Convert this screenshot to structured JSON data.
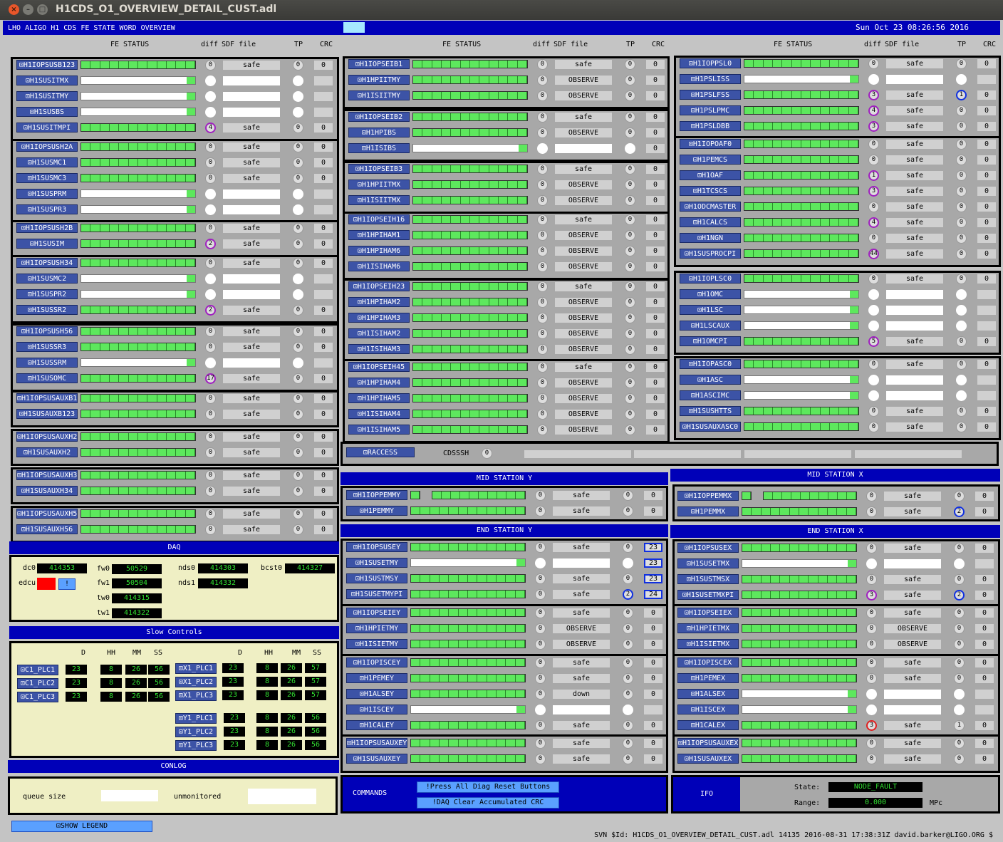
{
  "window": {
    "title": "H1CDS_O1_OVERVIEW_DETAIL_CUST.adl"
  },
  "header": {
    "title": "LHO ALIGO H1 CDS FE STATE WORD OVERVIEW",
    "datetime": "Sun Oct 23 08:26:56 2016"
  },
  "colheaders": {
    "fe": "FE STATUS",
    "diff": "diff",
    "sdf": "SDF file",
    "tp": "TP",
    "crc": "CRC"
  },
  "columns": [
    {
      "groups": [
        [
          [
            "H1IOPSUSB123",
            "g",
            "0",
            "safe",
            "0",
            "0"
          ],
          [
            "H1SUSITMX",
            "w",
            "",
            "",
            "",
            ""
          ],
          [
            "H1SUSITMY",
            "w",
            "",
            "",
            "",
            ""
          ],
          [
            "H1SUSBS",
            "w",
            "",
            "",
            "",
            ""
          ],
          [
            "H1SUSITMPI",
            "g",
            "4p",
            "safe",
            "0",
            "0"
          ]
        ],
        [
          [
            "H1IOPSUSH2A",
            "g",
            "0",
            "safe",
            "0",
            "0"
          ],
          [
            "H1SUSMC1",
            "g",
            "0",
            "safe",
            "0",
            "0"
          ],
          [
            "H1SUSMC3",
            "g",
            "0",
            "safe",
            "0",
            "0"
          ],
          [
            "H1SUSPRM",
            "w",
            "",
            "",
            "",
            ""
          ],
          [
            "H1SUSPR3",
            "w",
            "",
            "",
            "",
            ""
          ]
        ],
        [
          [
            "H1IOPSUSH2B",
            "g",
            "0",
            "safe",
            "0",
            "0"
          ],
          [
            "H1SUSIM",
            "g",
            "2p",
            "safe",
            "0",
            "0"
          ]
        ],
        [
          [
            "H1IOPSUSH34",
            "g",
            "0",
            "safe",
            "0",
            "0"
          ],
          [
            "H1SUSMC2",
            "w",
            "",
            "",
            "",
            ""
          ],
          [
            "H1SUSPR2",
            "w",
            "",
            "",
            "",
            ""
          ],
          [
            "H1SUSSR2",
            "g",
            "2p",
            "safe",
            "0",
            "0"
          ]
        ],
        [
          [
            "H1IOPSUSH56",
            "g",
            "0",
            "safe",
            "0",
            "0"
          ],
          [
            "H1SUSSR3",
            "g",
            "0",
            "safe",
            "0",
            "0"
          ],
          [
            "H1SUSSRM",
            "w",
            "",
            "",
            "",
            ""
          ],
          [
            "H1SUSOMC",
            "g",
            "17p",
            "safe",
            "0",
            "0"
          ]
        ],
        [
          [
            "H1IOPSUSAUXB123",
            "g",
            "0",
            "safe",
            "0",
            "0"
          ],
          [
            "H1SUSAUXB123",
            "g",
            "0",
            "safe",
            "0",
            "0"
          ]
        ],
        [
          [
            "H1IOPSUSAUXH2",
            "g",
            "0",
            "safe",
            "0",
            "0"
          ],
          [
            "H1SUSAUXH2",
            "g",
            "0",
            "safe",
            "0",
            "0"
          ]
        ],
        [
          [
            "H1IOPSUSAUXH34",
            "g",
            "0",
            "safe",
            "0",
            "0"
          ],
          [
            "H1SUSAUXH34",
            "g",
            "0",
            "safe",
            "0",
            "0"
          ]
        ],
        [
          [
            "H1IOPSUSAUXH56",
            "g",
            "0",
            "safe",
            "0",
            "0"
          ],
          [
            "H1SUSAUXH56",
            "g",
            "0",
            "safe",
            "0",
            "0"
          ]
        ]
      ]
    },
    {
      "groups": [
        [
          [
            "H1IOPSEIB1",
            "g",
            "0",
            "safe",
            "0",
            "0"
          ],
          [
            "H1HPIITMY",
            "g",
            "0",
            "OBSERVE",
            "0",
            "0"
          ],
          [
            "H1ISIITMY",
            "g",
            "0",
            "OBSERVE",
            "0",
            "0"
          ]
        ],
        [
          [
            "H1IOPSEIB2",
            "g",
            "0",
            "safe",
            "0",
            "0"
          ],
          [
            "H1HPIBS",
            "g",
            "0",
            "OBSERVE",
            "0",
            "0"
          ],
          [
            "H1ISIBS",
            "w",
            "",
            "",
            "",
            "0"
          ]
        ],
        [
          [
            "H1IOPSEIB3",
            "g",
            "0",
            "safe",
            "0",
            "0"
          ],
          [
            "H1HPIITMX",
            "g",
            "0",
            "OBSERVE",
            "0",
            "0"
          ],
          [
            "H1ISIITMX",
            "g",
            "0",
            "OBSERVE",
            "0",
            "0"
          ]
        ],
        [
          [
            "H1IOPSEIH16",
            "g",
            "0",
            "safe",
            "0",
            "0"
          ],
          [
            "H1HPIHAM1",
            "g",
            "0",
            "OBSERVE",
            "0",
            "0"
          ],
          [
            "H1HPIHAM6",
            "g",
            "0",
            "OBSERVE",
            "0",
            "0"
          ],
          [
            "H1ISIHAM6",
            "g",
            "0",
            "OBSERVE",
            "0",
            "0"
          ]
        ],
        [
          [
            "H1IOPSEIH23",
            "g",
            "0",
            "safe",
            "0",
            "0"
          ],
          [
            "H1HPIHAM2",
            "g",
            "0",
            "OBSERVE",
            "0",
            "0"
          ],
          [
            "H1HPIHAM3",
            "g",
            "0",
            "OBSERVE",
            "0",
            "0"
          ],
          [
            "H1ISIHAM2",
            "g",
            "0",
            "OBSERVE",
            "0",
            "0"
          ],
          [
            "H1ISIHAM3",
            "g",
            "0",
            "OBSERVE",
            "0",
            "0"
          ]
        ],
        [
          [
            "H1IOPSEIH45",
            "g",
            "0",
            "safe",
            "0",
            "0"
          ],
          [
            "H1HPIHAM4",
            "g",
            "0",
            "OBSERVE",
            "0",
            "0"
          ],
          [
            "H1HPIHAM5",
            "g",
            "0",
            "OBSERVE",
            "0",
            "0"
          ],
          [
            "H1ISIHAM4",
            "g",
            "0",
            "OBSERVE",
            "0",
            "0"
          ],
          [
            "H1ISIHAM5",
            "g",
            "0",
            "OBSERVE",
            "0",
            "0"
          ]
        ]
      ]
    },
    {
      "groups": [
        [
          [
            "H1IOPPSL0",
            "g",
            "0",
            "safe",
            "0",
            "0"
          ],
          [
            "H1PSLISS",
            "w",
            "",
            "",
            "",
            ""
          ],
          [
            "H1PSLFSS",
            "g",
            "3p",
            "safe",
            "1b",
            "0"
          ],
          [
            "H1PSLPMC",
            "g",
            "4p",
            "safe",
            "0",
            "0"
          ],
          [
            "H1PSLDBB",
            "g",
            "3p",
            "safe",
            "0",
            "0"
          ]
        ],
        [
          [
            "H1IOPOAF0",
            "g",
            "0",
            "safe",
            "0",
            "0"
          ],
          [
            "H1PEMCS",
            "g",
            "0",
            "safe",
            "0",
            "0"
          ],
          [
            "H1OAF",
            "g",
            "1p",
            "safe",
            "0",
            "0"
          ],
          [
            "H1TCSCS",
            "g",
            "3p",
            "safe",
            "0",
            "0"
          ],
          [
            "H1ODCMASTER",
            "g",
            "0",
            "safe",
            "0",
            "0"
          ],
          [
            "H1CALCS",
            "g",
            "4p",
            "safe",
            "0",
            "0"
          ],
          [
            "H1NGN",
            "g",
            "0",
            "safe",
            "0",
            "0"
          ],
          [
            "H1SUSPROCPI",
            "g",
            "44p",
            "safe",
            "0",
            "0"
          ]
        ],
        [
          [
            "H1IOPLSC0",
            "g",
            "0",
            "safe",
            "0",
            "0"
          ],
          [
            "H1OMC",
            "w",
            "",
            "",
            "",
            ""
          ],
          [
            "H1LSC",
            "w",
            "",
            "",
            "",
            ""
          ],
          [
            "H1LSCAUX",
            "w",
            "",
            "",
            "",
            ""
          ],
          [
            "H1OMCPI",
            "g",
            "5p",
            "safe",
            "0",
            "0"
          ]
        ],
        [
          [
            "H1IOPASC0",
            "g",
            "0",
            "safe",
            "0",
            "0"
          ],
          [
            "H1ASC",
            "w",
            "",
            "",
            "",
            ""
          ],
          [
            "H1ASCIMC",
            "w",
            "",
            "",
            "",
            ""
          ],
          [
            "H1SUSHTTS",
            "g",
            "0",
            "safe",
            "0",
            "0"
          ],
          [
            "H1SUSAUXASC0",
            "g",
            "0",
            "safe",
            "0",
            "0"
          ]
        ]
      ]
    }
  ],
  "raccess": {
    "button": "RACCESS",
    "label": "CDSSSH",
    "value": "0"
  },
  "midy": {
    "title": "MID STATION Y",
    "rows": [
      [
        "H1IOPPEMMY",
        "s",
        "0",
        "safe",
        "0",
        "0"
      ],
      [
        "H1PEMMY",
        "g",
        "0",
        "safe",
        "0",
        "0"
      ]
    ]
  },
  "midx": {
    "title": "MID STATION X",
    "rows": [
      [
        "H1IOPPEMMX",
        "s",
        "0",
        "safe",
        "0",
        "0"
      ],
      [
        "H1PEMMX",
        "g",
        "0",
        "safe",
        "2b",
        "0"
      ]
    ]
  },
  "endy": {
    "title": "END STATION Y",
    "groups": [
      [
        [
          "H1IOPSUSEY",
          "g",
          "0",
          "safe",
          "0",
          "23b"
        ],
        [
          "H1SUSETMY",
          "w",
          "",
          "",
          "",
          "23b"
        ],
        [
          "H1SUSTMSY",
          "g",
          "0",
          "safe",
          "0",
          "23b"
        ],
        [
          "H1SUSETMYPI",
          "g",
          "0",
          "safe",
          "2b",
          "24b"
        ]
      ],
      [
        [
          "H1IOPSEIEY",
          "g",
          "0",
          "safe",
          "0",
          "0"
        ],
        [
          "H1HPIETMY",
          "g",
          "0",
          "OBSERVE",
          "0",
          "0"
        ],
        [
          "H1ISIETMY",
          "g",
          "0",
          "OBSERVE",
          "0",
          "0"
        ]
      ],
      [
        [
          "H1IOPISCEY",
          "g",
          "0",
          "safe",
          "0",
          "0"
        ],
        [
          "H1PEMEY",
          "g",
          "0",
          "safe",
          "0",
          "0"
        ],
        [
          "H1ALSEY",
          "g",
          "0",
          "down",
          "0",
          "0"
        ],
        [
          "H1ISCEY",
          "w",
          "",
          "",
          "",
          ""
        ],
        [
          "H1CALEY",
          "g",
          "0",
          "safe",
          "0",
          "0"
        ]
      ],
      [
        [
          "H1IOPSUSAUXEY",
          "g",
          "0",
          "safe",
          "0",
          "0"
        ],
        [
          "H1SUSAUXEY",
          "g",
          "0",
          "safe",
          "0",
          "0"
        ]
      ]
    ]
  },
  "endx": {
    "title": "END STATION X",
    "groups": [
      [
        [
          "H1IOPSUSEX",
          "g",
          "0",
          "safe",
          "0",
          "0"
        ],
        [
          "H1SUSETMX",
          "w",
          "",
          "",
          "",
          ""
        ],
        [
          "H1SUSTMSX",
          "g",
          "0",
          "safe",
          "0",
          "0"
        ],
        [
          "H1SUSETMXPI",
          "g",
          "3p",
          "safe",
          "2b",
          "0"
        ]
      ],
      [
        [
          "H1IOPSEIEX",
          "g",
          "0",
          "safe",
          "0",
          "0"
        ],
        [
          "H1HPIETMX",
          "g",
          "0",
          "OBSERVE",
          "0",
          "0"
        ],
        [
          "H1ISIETMX",
          "g",
          "0",
          "OBSERVE",
          "0",
          "0"
        ]
      ],
      [
        [
          "H1IOPISCEX",
          "g",
          "0",
          "safe",
          "0",
          "0"
        ],
        [
          "H1PEMEX",
          "g",
          "0",
          "safe",
          "0",
          "0"
        ],
        [
          "H1ALSEX",
          "w",
          "",
          "",
          "",
          ""
        ],
        [
          "H1ISCEX",
          "w",
          "",
          "",
          "",
          ""
        ],
        [
          "H1CALEX",
          "g",
          "3r",
          "safe",
          "1",
          "0"
        ]
      ],
      [
        [
          "H1IOPSUSAUXEX",
          "g",
          "0",
          "safe",
          "0",
          "0"
        ],
        [
          "H1SUSAUXEX",
          "g",
          "0",
          "safe",
          "0",
          "0"
        ]
      ]
    ]
  },
  "daq": {
    "title": "DAQ",
    "dc0": "414353",
    "fw0": "50529",
    "fw1": "50504",
    "tw0": "414315",
    "tw1": "414322",
    "nds0": "414303",
    "nds1": "414332",
    "bcst0": "414327",
    "labels": {
      "dc0": "dc0",
      "edcu": "edcu",
      "fw0": "fw0",
      "fw1": "fw1",
      "tw0": "tw0",
      "tw1": "tw1",
      "nds0": "nds0",
      "nds1": "nds1",
      "bcst0": "bcst0"
    },
    "edcu_btn": "!"
  },
  "slow": {
    "title": "Slow Controls",
    "hdr": [
      "D",
      "HH",
      "MM",
      "SS"
    ],
    "left": [
      [
        "C1_PLC1",
        "23",
        "8",
        "26",
        "56"
      ],
      [
        "C1_PLC2",
        "23",
        "8",
        "26",
        "56"
      ],
      [
        "C1_PLC3",
        "23",
        "8",
        "26",
        "56"
      ]
    ],
    "midc": [
      [
        "X1_PLC1",
        "23",
        "8",
        "26",
        "57"
      ],
      [
        "X1_PLC2",
        "23",
        "8",
        "26",
        "57"
      ],
      [
        "X1_PLC3",
        "23",
        "8",
        "26",
        "57"
      ]
    ],
    "midy": [
      [
        "Y1_PLC1",
        "23",
        "8",
        "26",
        "56"
      ],
      [
        "Y1_PLC2",
        "23",
        "8",
        "26",
        "56"
      ],
      [
        "Y1_PLC3",
        "23",
        "8",
        "26",
        "56"
      ]
    ]
  },
  "conlog": {
    "title": "CONLOG",
    "queue": "queue size",
    "unmon": "unmonitored"
  },
  "legend": "SHOW LEGEND",
  "commands": {
    "title": "COMMANDS",
    "btn1": "!Press All Diag Reset Buttons",
    "btn2": "!DAQ Clear Accumulated CRC"
  },
  "ifo": {
    "title": "IFO",
    "state_label": "State:",
    "state": "NODE_FAULT",
    "range_label": "Range:",
    "range": "0.000",
    "unit": "MPc"
  },
  "footer": "SVN $Id: H1CDS_O1_OVERVIEW_DETAIL_CUST.adl 14135 2016-08-31 17:38:31Z david.barker@LIGO.ORG $"
}
